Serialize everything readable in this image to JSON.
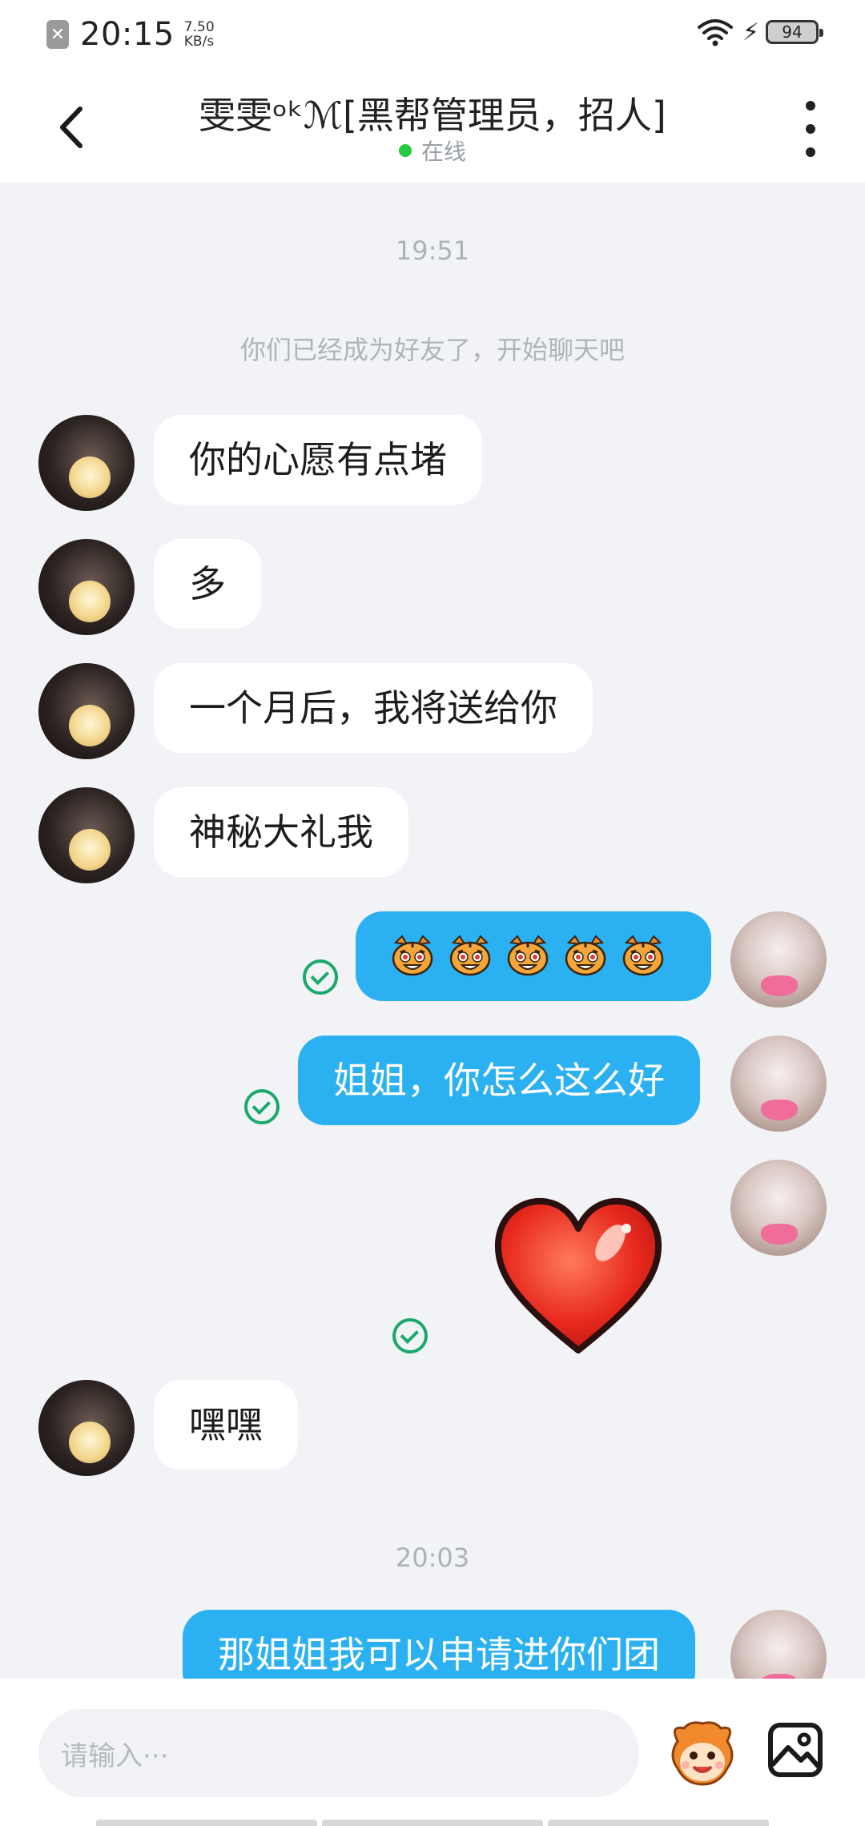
{
  "status_bar": {
    "time": "20:15",
    "speed_value": "7.50",
    "speed_unit": "KB/s",
    "battery": "94",
    "icons": [
      "notification-x-icon",
      "wifi-icon",
      "charging-bolt-icon",
      "battery-icon"
    ]
  },
  "header": {
    "title": "雯雯ᵒᵏℳ[黑帮管理员，招人]",
    "status": "在线",
    "icons": [
      "back-arrow-icon",
      "more-vertical-icon"
    ]
  },
  "chat": {
    "timestamp_1": "19:51",
    "system_message": "你们已经成为好友了，开始聊天吧",
    "messages": [
      {
        "from": "other",
        "text": "你的心愿有点堵"
      },
      {
        "from": "other",
        "text": "多"
      },
      {
        "from": "other",
        "text": "一个月后，我将送给你"
      },
      {
        "from": "other",
        "text": "神秘大礼我"
      },
      {
        "from": "me",
        "type": "emoji",
        "emoji": "tiger-emoji",
        "count": 5,
        "read": true
      },
      {
        "from": "me",
        "text": "姐姐，你怎么这么好",
        "read": true
      },
      {
        "from": "me",
        "type": "sticker",
        "sticker": "red-heart",
        "read": true
      },
      {
        "from": "other",
        "text": "嘿嘿"
      },
      {
        "from": "me",
        "text": "那姐姐我可以申请进你们团"
      }
    ],
    "timestamp_2": "20:03"
  },
  "input_bar": {
    "placeholder": "请输入···",
    "icons": [
      "sticker-mascot-icon",
      "image-picker-icon"
    ]
  },
  "colors": {
    "my_bubble": "#2bb1f2",
    "other_bubble": "#ffffff",
    "background": "#f2f3f7",
    "read_check": "#1aa86b",
    "online": "#27c93f"
  }
}
